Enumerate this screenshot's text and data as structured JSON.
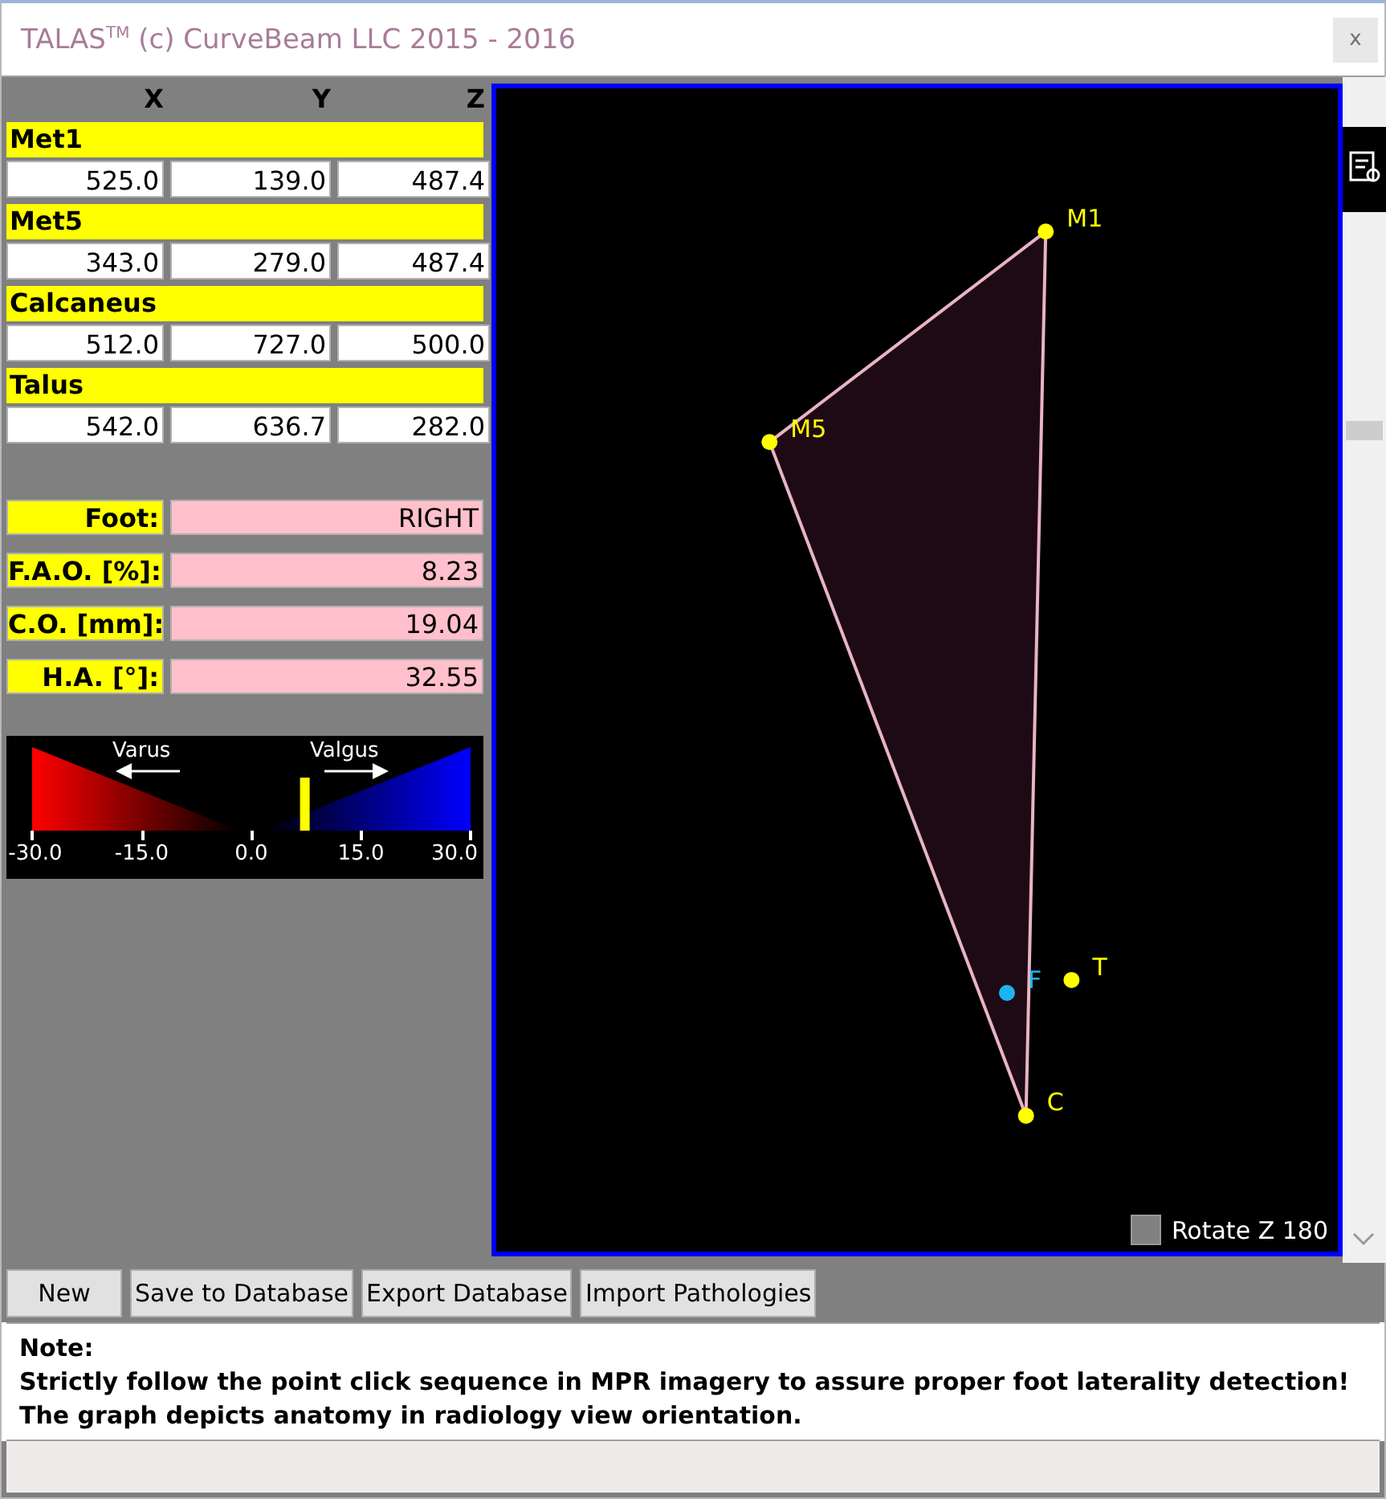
{
  "window": {
    "title": "TALAS$^{TM}$ (c) CurveBeam LLC 2015 - 2016",
    "close": "x"
  },
  "table": {
    "columns": [
      "X",
      "Y",
      "Z"
    ],
    "landmarks": [
      {
        "name": "Met1",
        "values": [
          "525.0",
          "139.0",
          "487.4"
        ]
      },
      {
        "name": "Met5",
        "values": [
          "343.0",
          "279.0",
          "487.4"
        ]
      },
      {
        "name": "Calcaneus",
        "values": [
          "512.0",
          "727.0",
          "500.0"
        ]
      },
      {
        "name": "Talus",
        "values": [
          "542.0",
          "636.7",
          "282.0"
        ]
      }
    ]
  },
  "results": [
    {
      "label": "Foot:",
      "value": "RIGHT"
    },
    {
      "label": "F.A.O. [%]:",
      "value": "8.23"
    },
    {
      "label": "C.O. [mm]:",
      "value": "19.04"
    },
    {
      "label": "H.A. [°]:",
      "value": "32.55"
    }
  ],
  "gauge": {
    "left_label": "Varus",
    "right_label": "Valgus",
    "ticks": [
      "-30.0",
      "-15.0",
      "0.0",
      "15.0",
      "30.0"
    ],
    "level": 0.637
  },
  "canvas": {
    "points": [
      {
        "label": "M1",
        "kind": "met1",
        "color": "#ffff00"
      },
      {
        "label": "M5",
        "kind": "met5",
        "color": "#ffff00"
      },
      {
        "label": "F",
        "kind": "computed",
        "color": "#1eb4f0"
      },
      {
        "label": "T",
        "kind": "talus",
        "color": "#ffff00"
      },
      {
        "label": "C",
        "kind": "calcaneus",
        "color": "#ffff00"
      }
    ],
    "rotate": {
      "label": "Rotate Z 180",
      "checked": false
    }
  },
  "buttons": [
    "New",
    "Save to Database",
    "Export Database",
    "Import Pathologies"
  ],
  "note": {
    "title": "Note:",
    "lines": [
      "Strictly follow the point click sequence in MPR imagery to assure proper foot laterality detection!",
      "The graph depicts anatomy in radiology view orientation."
    ]
  }
}
